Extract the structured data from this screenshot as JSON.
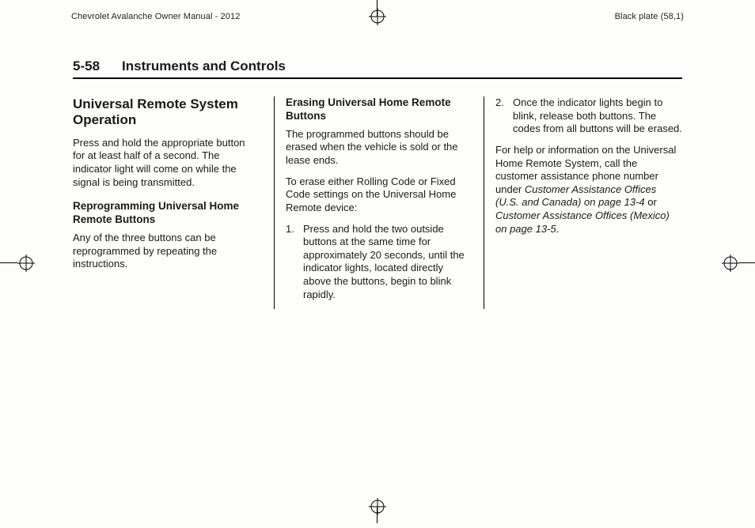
{
  "header": {
    "manual_title": "Chevrolet Avalanche Owner Manual - 2012",
    "plate_text": "Black plate (58,1)"
  },
  "running_head": {
    "page_number": "5-58",
    "chapter_title": "Instruments and Controls"
  },
  "col1": {
    "section_title": "Universal Remote System Operation",
    "intro": "Press and hold the appropriate button for at least half of a second. The indicator light will come on while the signal is being transmitted.",
    "sub1_title": "Reprogramming Universal Home Remote Buttons",
    "sub1_body": "Any of the three buttons can be reprogrammed by repeating the instructions."
  },
  "col2": {
    "sub_title": "Erasing Universal Home Remote Buttons",
    "p1": "The programmed buttons should be erased when the vehicle is sold or the lease ends.",
    "p2": "To erase either Rolling Code or Fixed Code settings on the Universal Home Remote device:",
    "step1_num": "1.",
    "step1_text": "Press and hold the two outside buttons at the same time for approximately 20 seconds, until the indicator lights, located directly above the buttons, begin to blink rapidly."
  },
  "col3": {
    "step2_num": "2.",
    "step2_text": "Once the indicator lights begin to blink, release both buttons. The codes from all buttons will be erased.",
    "help_pre": "For help or information on the Universal Home Remote System, call the customer assistance phone number under ",
    "help_ref1": "Customer Assistance Offices (U.S. and Canada) on page 13‑4",
    "help_mid": " or ",
    "help_ref2": "Customer Assistance Offices (Mexico) on page 13‑5",
    "help_period": "."
  }
}
